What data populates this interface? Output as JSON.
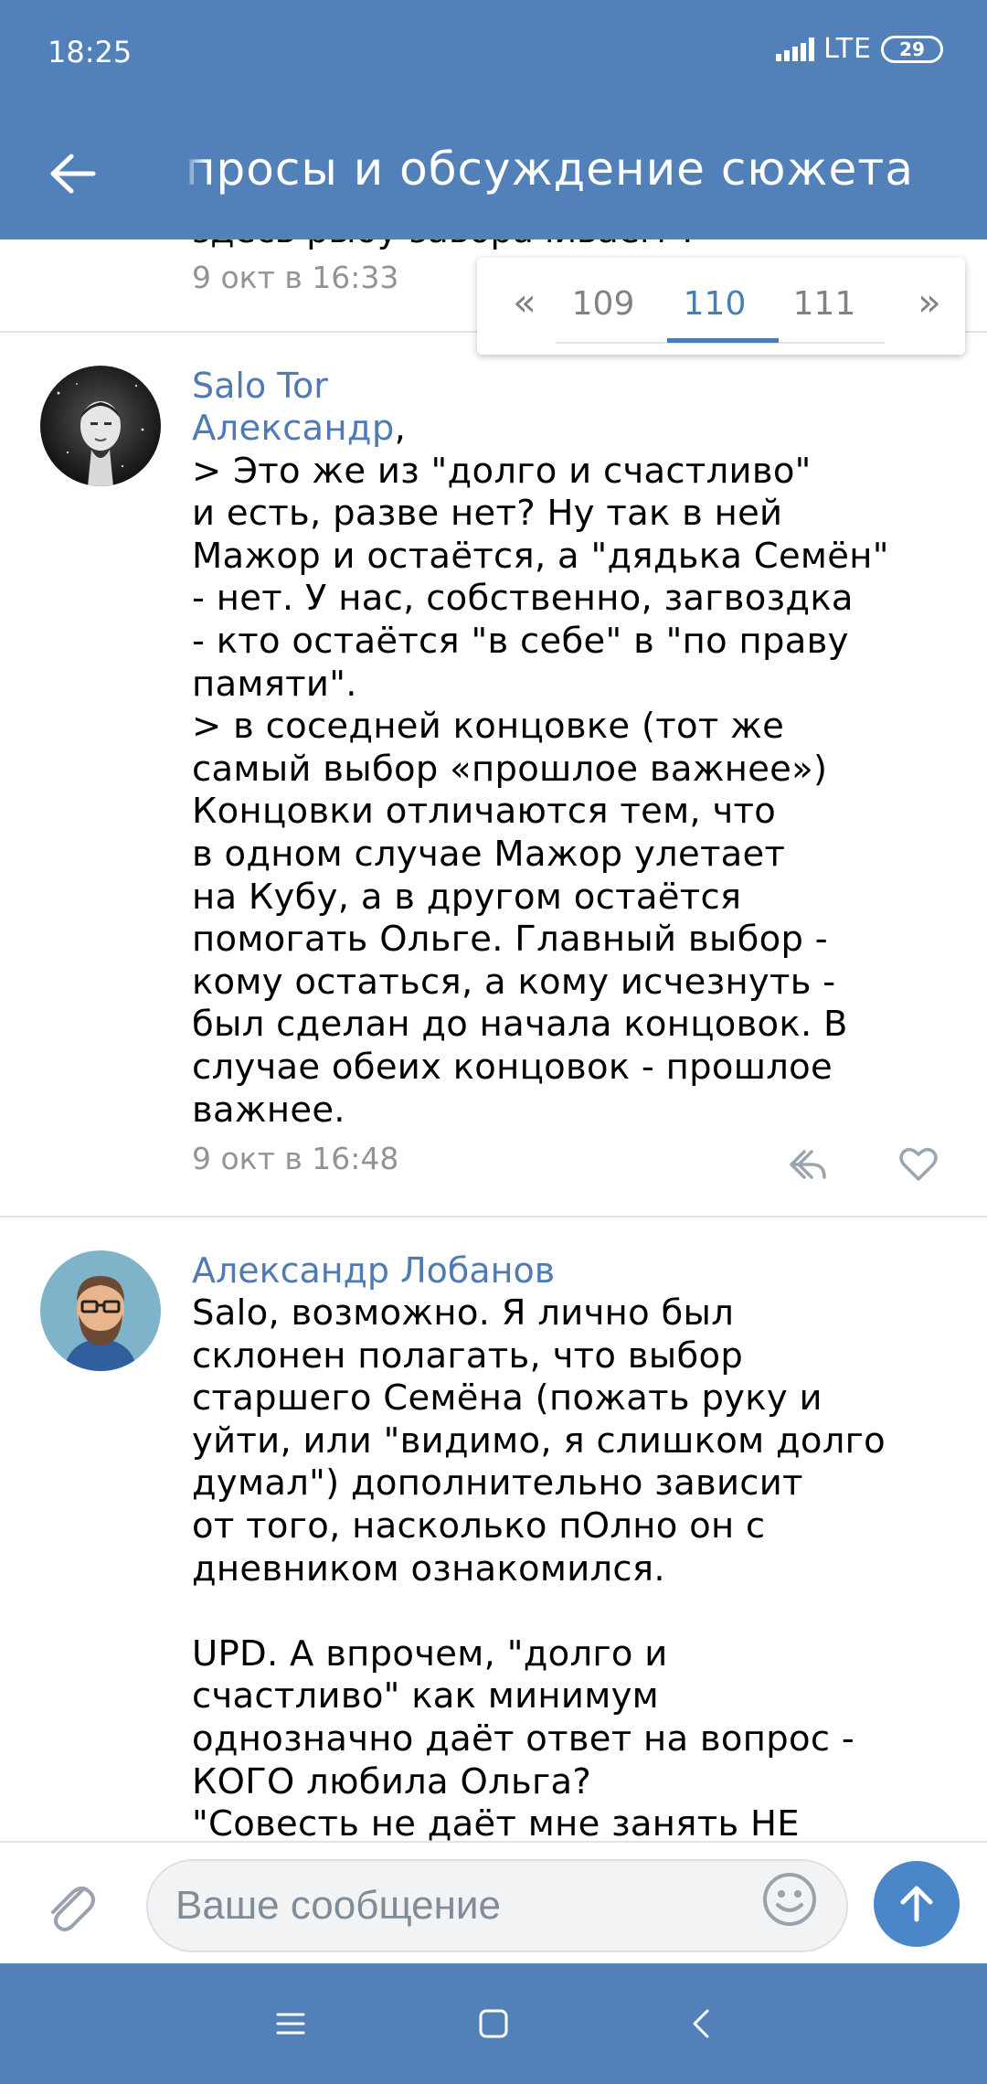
{
  "status_bar": {
    "time": "18:25",
    "network": "LTE",
    "battery": "29"
  },
  "header": {
    "title": "Вопросы и обсуждение сюжета"
  },
  "previous_comment": {
    "tail_text": "здесь рыбу заворачиваем\".",
    "date": "9 окт в 16:33"
  },
  "pagination": {
    "first": "«",
    "last": "»",
    "pages": [
      "109",
      "110",
      "111"
    ],
    "active": "110"
  },
  "comments": [
    {
      "author": "Salo Tor",
      "reply_to": "Александр",
      "text": "> Это же из \"долго и счастливо\"\nи есть, разве нет? Ну так в ней\nМажор и остаётся, а \"дядька Семён\"\n- нет. У нас, собственно, загвоздка\n- кто остаётся \"в себе\" в \"по праву\nпамяти\".\n> в соседней концовке (тот же\nсамый выбор «прошлое важнее»)\nКонцовки отличаются тем, что\nв одном случае Мажор улетает\nна Кубу, а в другом остаётся\nпомогать Ольге. Главный выбор -\nкому остаться, а кому исчезнуть -\nбыл сделан до начала концовок. В\nслучае обеих концовок - прошлое\nважнее.",
      "date": "9 окт в 16:48"
    },
    {
      "author": "Александр Лобанов",
      "text": "Salo, возможно. Я лично был\nсклонен полагать, что выбор\nстаршего Семёна (пожать руку и\nуйти, или \"видимо, я слишком долго\nдумал\") дополнительно зависит\nот того, насколько пОлно он с\nдневником ознакомился.\n\nUPD. А впрочем, \"долго и\nсчастливо\" как минимум\nоднозначно даёт ответ на вопрос -\nКОГО любила Ольга?\n\"Совесть не даёт мне занять НЕ"
    }
  ],
  "composer": {
    "placeholder": "Ваше сообщение"
  },
  "colors": {
    "header": "#5181b8",
    "link": "#4f7ab2",
    "send_button": "#4a86c8"
  },
  "icons": [
    "back-arrow-icon",
    "reply-icon",
    "heart-icon",
    "paperclip-icon",
    "smile-icon",
    "arrow-up-icon",
    "menu-icon",
    "home-square-icon",
    "back-chevron-icon"
  ]
}
